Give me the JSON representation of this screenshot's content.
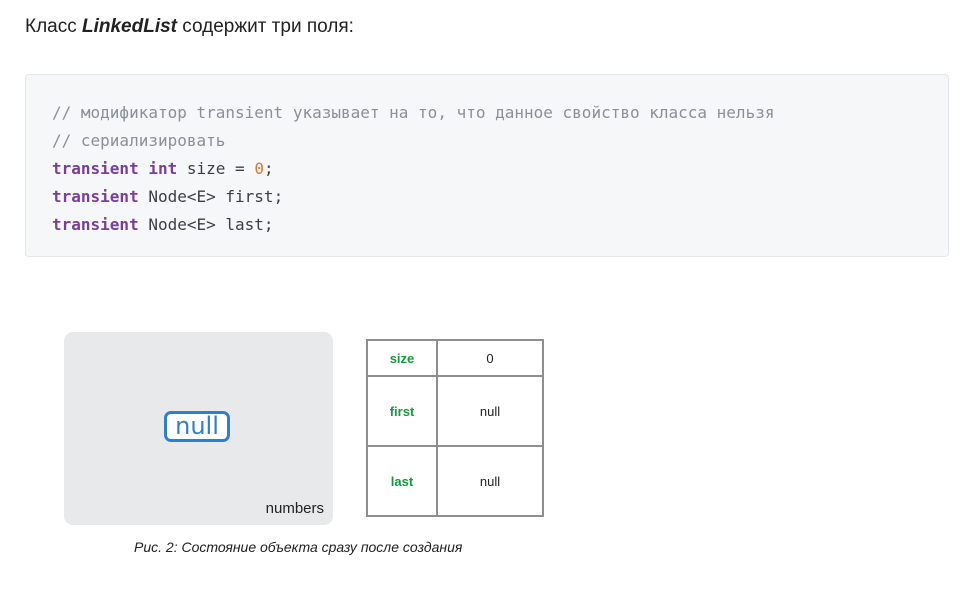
{
  "intro": {
    "prefix": "Класс ",
    "class_name": "LinkedList",
    "suffix": " содержит три поля:"
  },
  "code": {
    "comment_line_1": "// модификатор transient указывает на то, что данное свойство класса нельзя",
    "comment_line_2": "// сериализировать",
    "line_size": {
      "kw1": "transient",
      "kw2": "int",
      "rest": " size = ",
      "num": "0",
      "end": ";"
    },
    "line_first": {
      "kw": "transient",
      "rest": " Node<E> first;"
    },
    "line_last": {
      "kw": "transient",
      "rest": " Node<E> last;"
    }
  },
  "figure": {
    "null_label": "null",
    "panel_label": "numbers",
    "fields": [
      {
        "name": "size",
        "value": "0"
      },
      {
        "name": "first",
        "value": "null"
      },
      {
        "name": "last",
        "value": "null"
      }
    ],
    "caption": "Рис. 2: Состояние объекта сразу после создания"
  },
  "colors": {
    "keyword": "#7a3e9d",
    "comment": "#8a8f98",
    "number": "#e8742b",
    "field_name": "#159a3e",
    "null_box": "#2f7fd1"
  }
}
